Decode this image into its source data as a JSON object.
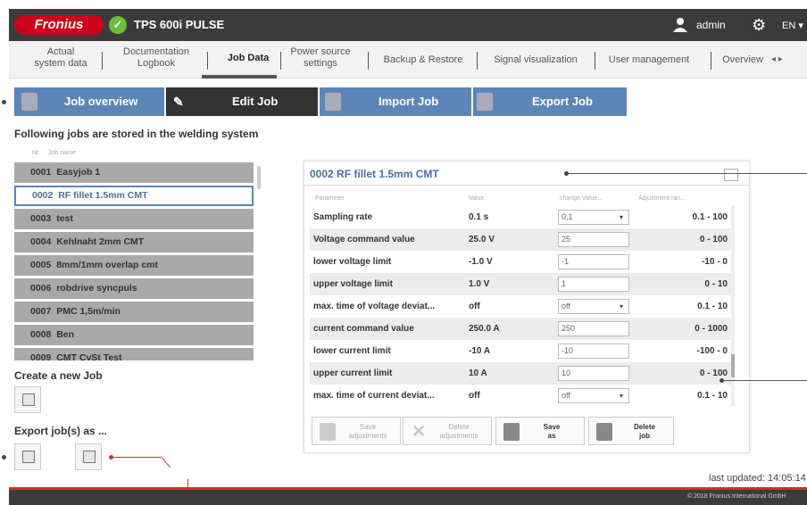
{
  "header": {
    "brand": "Fronius",
    "device_name": "TPS 600i PULSE",
    "user": "admin",
    "language": "EN ▾"
  },
  "nav": {
    "tabs": [
      {
        "label": "Actual\nsystem data"
      },
      {
        "label": "Documentation\nLogbook"
      },
      {
        "label": "Job Data"
      },
      {
        "label": "Power source\nsettings"
      },
      {
        "label": "Backup & Restore"
      },
      {
        "label": "Signal visualization"
      },
      {
        "label": "User management"
      },
      {
        "label": "Overview"
      }
    ],
    "arrows": "◂  ▸"
  },
  "actions": {
    "job_overview": "Job overview",
    "edit_job": "Edit Job",
    "import_job": "Import Job",
    "export_job": "Export Job"
  },
  "jobs_section": {
    "title": "Following jobs are stored in the welding system",
    "col_nr": "Nr.",
    "col_name": "Job name",
    "jobs": [
      {
        "nr": "0001",
        "name": "Easyjob 1"
      },
      {
        "nr": "0002",
        "name": "RF fillet 1.5mm CMT"
      },
      {
        "nr": "0003",
        "name": "test"
      },
      {
        "nr": "0004",
        "name": "Kehlnaht 2mm CMT"
      },
      {
        "nr": "0005",
        "name": "8mm/1mm overlap cmt"
      },
      {
        "nr": "0006",
        "name": "robdrive syncpuls"
      },
      {
        "nr": "0007",
        "name": "PMC 1,5m/min"
      },
      {
        "nr": "0008",
        "name": "Ben"
      },
      {
        "nr": "0009",
        "name": "CMT CvSt Test"
      }
    ],
    "selected_index": 1
  },
  "create_section": {
    "title": "Create a new Job"
  },
  "export_section": {
    "title": "Export job(s) as ..."
  },
  "detail": {
    "title": "0002 RF fillet 1.5mm CMT",
    "headers": {
      "parameter": "Parameter",
      "value": "Value",
      "change": "change Value...",
      "range": "Adjustment ran..."
    },
    "rows": [
      {
        "name": "Sampling rate",
        "value": "0.1 s",
        "input": "0,1",
        "dropdown": true,
        "range": "0.1 - 100"
      },
      {
        "name": "Voltage command value",
        "value": "25.0 V",
        "input": "25",
        "dropdown": false,
        "range": "0 - 100"
      },
      {
        "name": "lower voltage limit",
        "value": "-1.0 V",
        "input": "-1",
        "dropdown": false,
        "range": "-10 - 0"
      },
      {
        "name": "upper voltage limit",
        "value": "1.0 V",
        "input": "1",
        "dropdown": false,
        "range": "0 - 10"
      },
      {
        "name": "max. time of voltage deviat...",
        "value": "off",
        "input": "off",
        "dropdown": true,
        "range": "0.1 - 10"
      },
      {
        "name": "current command value",
        "value": "250.0 A",
        "input": "250",
        "dropdown": false,
        "range": "0 - 1000"
      },
      {
        "name": "lower current limit",
        "value": "-10 A",
        "input": "-10",
        "dropdown": false,
        "range": "-100 - 0"
      },
      {
        "name": "upper current limit",
        "value": "10 A",
        "input": "10",
        "dropdown": false,
        "range": "0 - 100"
      },
      {
        "name": "max. time of current deviat...",
        "value": "off",
        "input": "off",
        "dropdown": true,
        "range": "0.1 - 10"
      }
    ],
    "buttons": {
      "save_adjustments": "Save\nadjustments",
      "delete_adjustments": "Delete\nadjustments",
      "save_as": "Save\nas",
      "delete_job": "Delete\njob"
    }
  },
  "footer": {
    "last_updated": "last updated: 14:05:14",
    "copyright": "© 2018 Fronius International GmbH"
  },
  "colors": {
    "accent_blue": "#5d86b8",
    "brand_red": "#d0021b",
    "header_dark": "#3b3b3b"
  }
}
